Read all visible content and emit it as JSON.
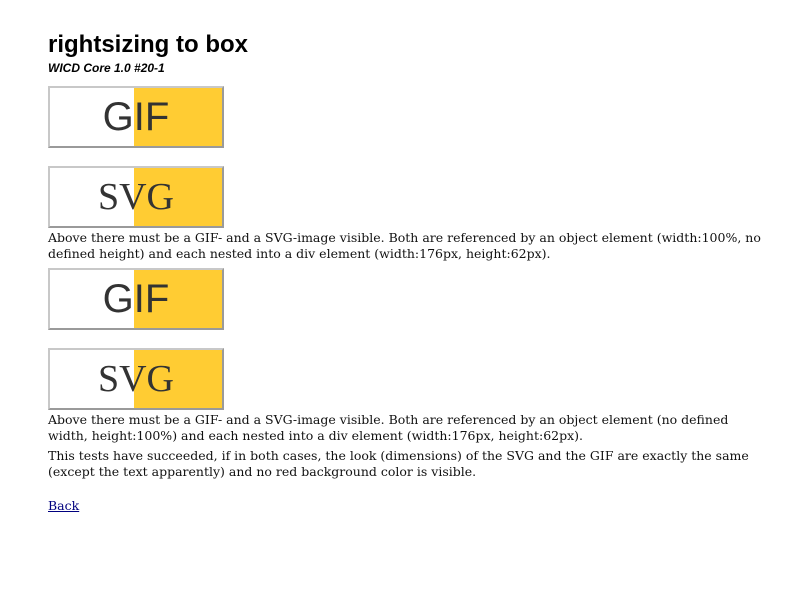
{
  "page": {
    "title": "rightsizing to box",
    "subtitle": "WICD Core 1.0 #20-1"
  },
  "section1": {
    "gif_label": "GIF",
    "svg_label": "SVG",
    "description": "Above there must be a GIF- and a SVG-image visible. Both are referenced by an object element (width:100%, no defined height) and each nested into a div element (width:176px, height:62px)."
  },
  "section2": {
    "gif_label": "GIF",
    "svg_label": "SVG",
    "description": "Above there must be a GIF- and a SVG-image visible. Both are referenced by an object element (no defined width, height:100%) and each nested into a div element (width:176px, height:62px).",
    "success_note": "This tests have succeeded, if in both cases, the look (dimensions) of the SVG and the GIF are exactly the same (except the text apparently) and no red background color is visible."
  },
  "nav": {
    "back_label": "Back"
  },
  "colors": {
    "image_fill": "#ffcc33",
    "image_text": "#333333",
    "link": "#00007f"
  }
}
